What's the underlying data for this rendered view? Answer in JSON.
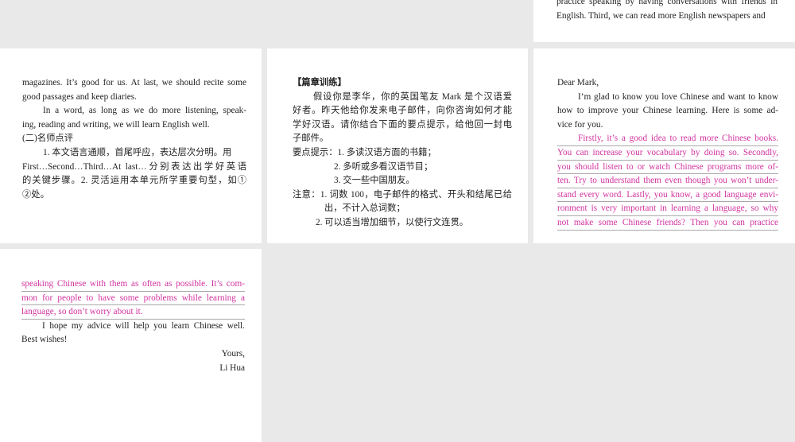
{
  "tiles": [
    {
      "name": "slide-essay-end-top",
      "lines": [
        "practice speaking by having conversations with friends in",
        "English. Third, we can read more English newspapers and"
      ]
    },
    {
      "name": "slide-essay-conclusion",
      "lines": [
        "magazines. It’s good for us. At last, we should recite some",
        "good passages and keep diaries.",
        "In a word, as long as we do more listening, speak-",
        "ing, reading and writing, we will learn English well.",
        "(二)名师点评",
        "1. 本文语言通顺，首尾呼应，表达层次分明。用",
        "First…Second…Third…At last…分别表达出学好英语",
        "的关键步骤。2. 灵活运用本单元所学重要句型，如①",
        "②处。"
      ]
    },
    {
      "name": "slide-chapter-practice",
      "lines": [
        "【篇章训练】",
        "假设你是李华，你的英国笔友 Mark 是个汉语爱",
        "好者。昨天他给你发来电子邮件，向你咨询如何才能",
        "学好汉语。请你结合下面的要点提示，给他回一封电",
        "子邮件。",
        "要点提示：1. 多读汉语方面的书籍；",
        "2. 多听或多看汉语节目；",
        "3. 交一些中国朋友。",
        "注意：1. 词数 100，电子邮件的格式、开头和结尾已给",
        "出，不计入总词数；",
        "2. 可以适当增加细节，以使行文连贯。"
      ]
    },
    {
      "name": "slide-letter-start",
      "lines": [
        "Dear Mark,",
        "I’m glad to know you love Chinese and want to know",
        "how to improve your Chinese learning. Here is some ad-",
        "vice for you.",
        "Firstly, it’s a good idea to read more Chinese books.",
        "You can increase your vocabulary by doing so. Secondly,",
        "you should listen to or watch Chinese programs more of-",
        "ten. Try to understand them even though you won’t under-",
        "stand every word. Lastly, you know, a good language envi-",
        "ronment is very important in learning a language, so why",
        "not make some Chinese friends? Then you can practice"
      ]
    },
    {
      "name": "slide-letter-end",
      "lines": [
        "speaking Chinese with them as often as possible. It’s com-",
        "mon for people to have some problems while learning a",
        "language, so don’t worry about it.",
        "I hope my advice will help you learn Chinese well.",
        "Best wishes!",
        "Yours,",
        "Li Hua"
      ]
    }
  ],
  "colors": {
    "highlight": "#d2329f",
    "background": "#e9e9e9",
    "tile": "#ffffff"
  }
}
